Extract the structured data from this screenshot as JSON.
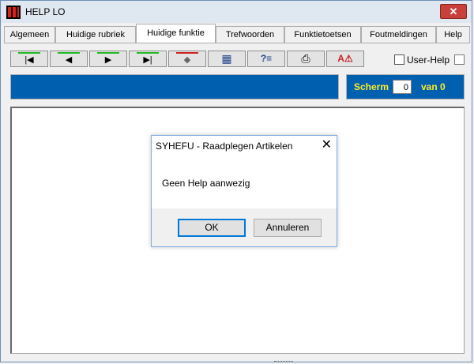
{
  "window": {
    "title": "HELP LO",
    "close_glyph": "✕"
  },
  "tabs": [
    {
      "label": "Algemeen"
    },
    {
      "label": "Huidige rubriek"
    },
    {
      "label": "Huidige funktie",
      "active": true
    },
    {
      "label": "Trefwoorden"
    },
    {
      "label": "Funktietoetsen"
    },
    {
      "label": "Foutmeldingen"
    },
    {
      "label": "Help"
    }
  ],
  "toolbar": {
    "buttons": [
      {
        "icon": "first-icon",
        "glyph": "|◀"
      },
      {
        "icon": "previous-icon",
        "glyph": "◀"
      },
      {
        "icon": "next-icon",
        "glyph": "▶"
      },
      {
        "icon": "last-icon",
        "glyph": "▶|"
      },
      {
        "icon": "back-icon",
        "glyph": "◆"
      },
      {
        "icon": "book-icon",
        "glyph": "▦"
      },
      {
        "icon": "help-search-icon",
        "glyph": "?≡"
      },
      {
        "icon": "printer-icon",
        "glyph": "⎙"
      },
      {
        "icon": "warning-tools-icon",
        "glyph": "A⚠"
      }
    ],
    "bar_colors": [
      "#22bb22",
      "#22bb22",
      "#22bb22",
      "#22bb22",
      "#cc2222"
    ]
  },
  "user_help": {
    "label": "User-Help",
    "checked": false
  },
  "scherm": {
    "label": "Scherm",
    "value": "0",
    "of_label": "van 0"
  },
  "dialog": {
    "title": "SYHEFU - Raadplegen Artikelen",
    "close_glyph": "✕",
    "message": "Geen Help aanwezig",
    "ok_label": "OK",
    "cancel_label": "Annuleren"
  },
  "colors": {
    "panel_blue": "#0060b0",
    "scherm_text": "#ffea28",
    "title_bar": "#dfe7f1",
    "close_red": "#c9403a",
    "dialog_focus": "#0078d7"
  }
}
